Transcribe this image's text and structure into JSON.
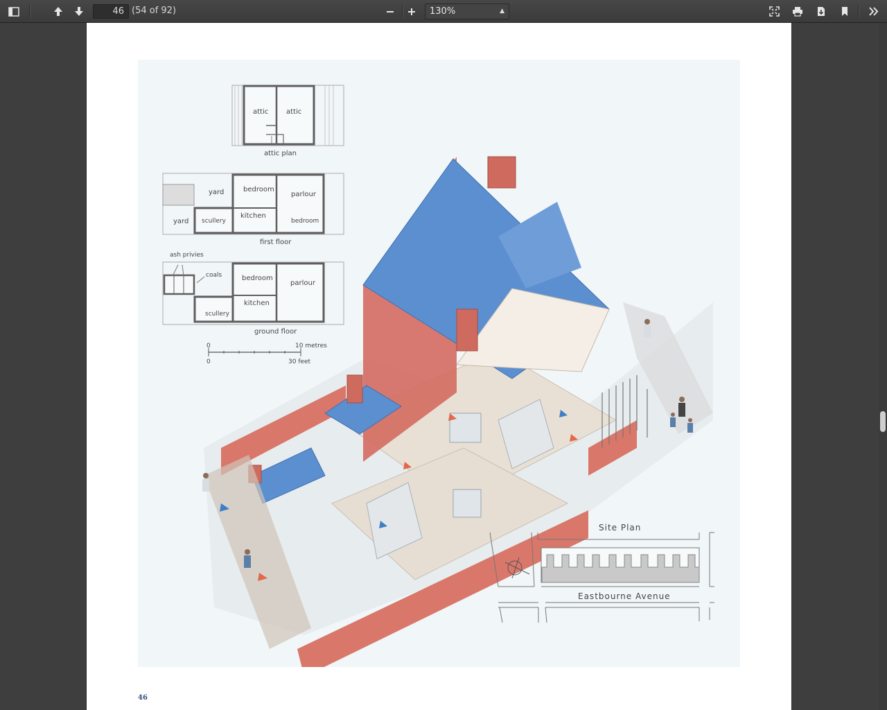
{
  "toolbar": {
    "current_page": "46",
    "page_count_label": "(54 of 92)",
    "zoom": "130%",
    "icons": [
      "sidebar-toggle-icon",
      "previous-page-icon",
      "next-page-icon",
      "zoom-out-icon",
      "zoom-in-icon",
      "presentation-mode-icon",
      "print-icon",
      "download-icon",
      "bookmark-icon",
      "tools-menu-icon"
    ]
  },
  "page": {
    "number": "46",
    "plans": {
      "attic": {
        "caption": "attic plan",
        "rooms": [
          "attic",
          "attic"
        ]
      },
      "first": {
        "caption": "first floor",
        "rooms": [
          "yard",
          "bedroom",
          "parlour",
          "yard",
          "scullery",
          "kitchen",
          "bedroom"
        ]
      },
      "ground": {
        "caption": "ground floor",
        "rooms": [
          "ash privies",
          "coals",
          "bedroom",
          "parlour",
          "kitchen",
          "scullery"
        ]
      }
    },
    "scale": {
      "zero_top": "0",
      "metres": "10 metres",
      "zero_bottom": "0",
      "feet": "30 feet"
    },
    "site_plan": {
      "title": "Site Plan",
      "street": "Eastbourne Avenue"
    }
  },
  "colors": {
    "roof": "#5b8fd0",
    "brick": "#d9776a",
    "floor": "#e6ded3",
    "arrow_red": "#e2684b",
    "arrow_blue": "#3f7ec6"
  }
}
